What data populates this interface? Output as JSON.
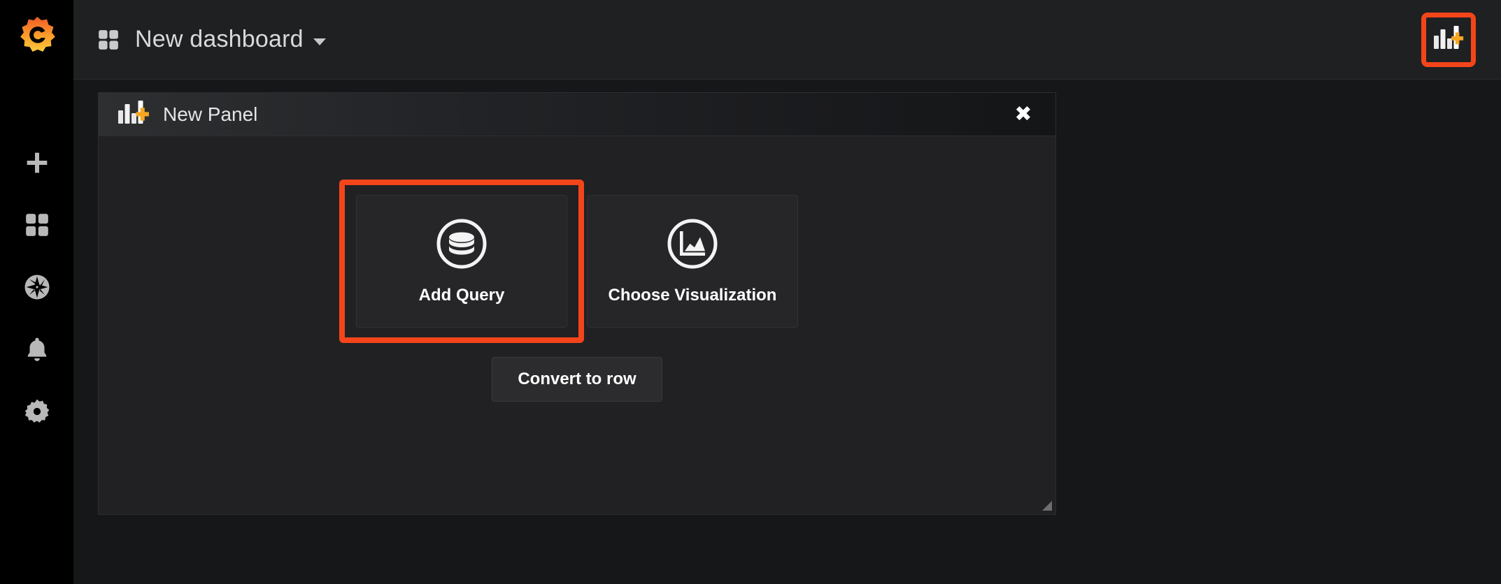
{
  "app": {
    "brand_icon": "grafana-logo",
    "brand_color": "#f59f00",
    "accent_highlight_color": "#f4451a",
    "background_color": "#161719"
  },
  "sidebar": {
    "items": [
      {
        "id": "create",
        "icon": "plus-icon",
        "label": "Create"
      },
      {
        "id": "dashboards",
        "icon": "dashboards-grid-icon",
        "label": "Dashboards"
      },
      {
        "id": "explore",
        "icon": "compass-icon",
        "label": "Explore"
      },
      {
        "id": "alerting",
        "icon": "bell-icon",
        "label": "Alerting"
      },
      {
        "id": "configuration",
        "icon": "gear-icon",
        "label": "Configuration"
      }
    ]
  },
  "navbar": {
    "dashboard_icon": "dashboards-grid-icon",
    "title": "New dashboard",
    "caret": "chevron-down-icon",
    "actions": [
      {
        "id": "add-panel",
        "icon": "add-panel-icon",
        "label": "Add panel",
        "highlighted": true
      }
    ]
  },
  "panel": {
    "icon": "add-panel-icon",
    "title": "New Panel",
    "close_label": "✖",
    "cards": [
      {
        "id": "add-query",
        "icon": "database-icon",
        "label": "Add Query",
        "highlighted": true
      },
      {
        "id": "choose-visualization",
        "icon": "area-chart-icon",
        "label": "Choose Visualization",
        "highlighted": false
      }
    ],
    "convert_button_label": "Convert to row",
    "resize_handle": "resize-handle-icon"
  }
}
